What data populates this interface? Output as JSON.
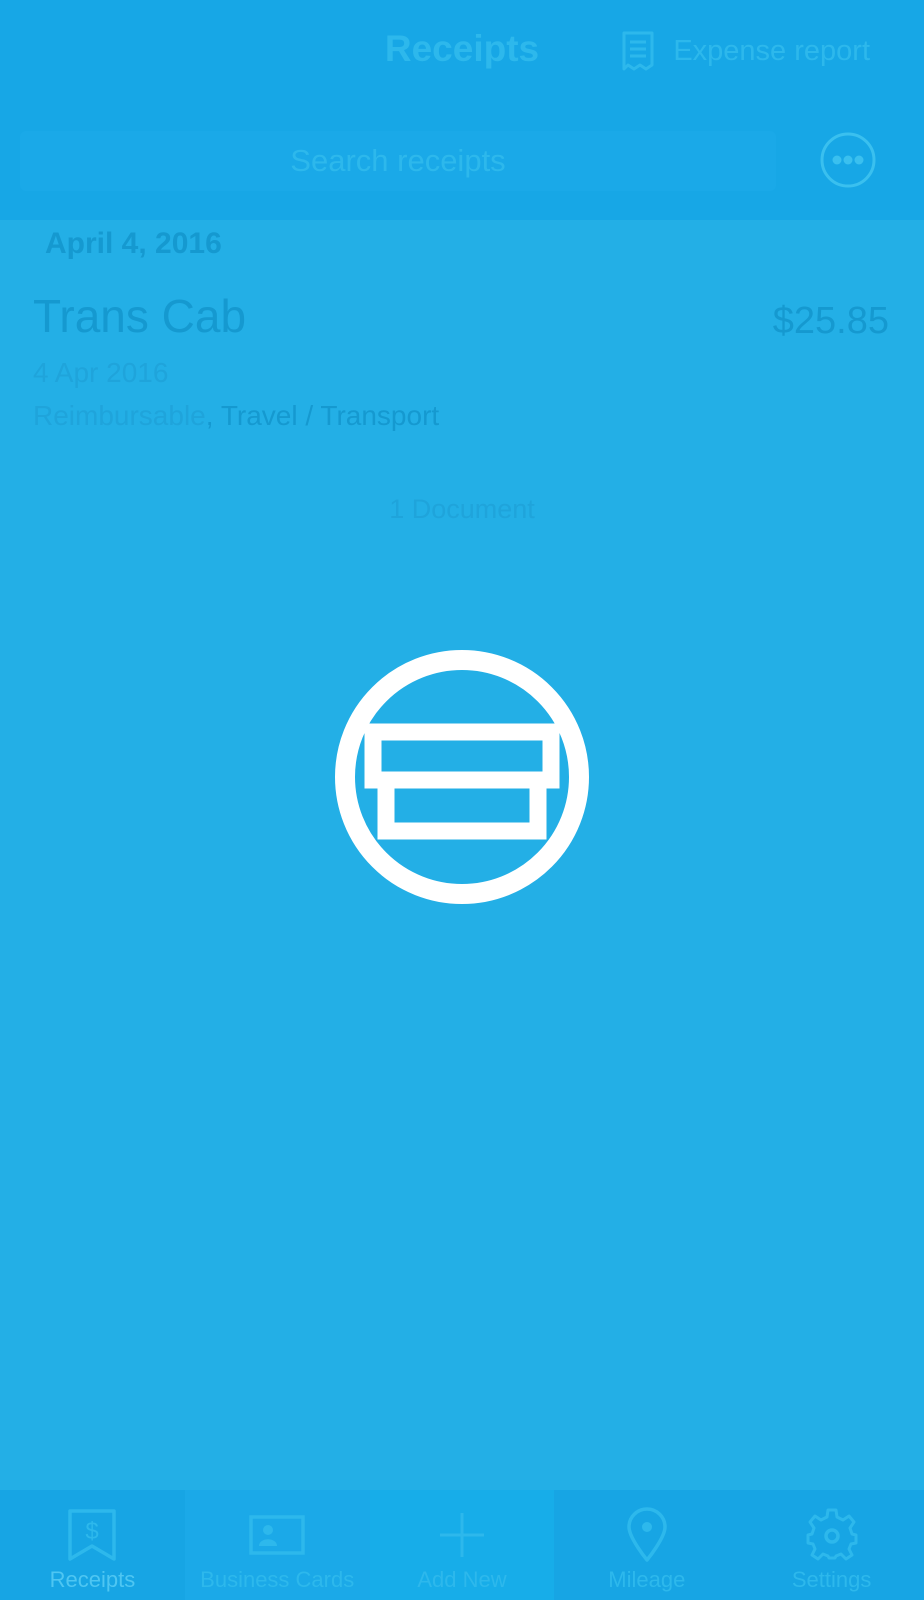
{
  "header": {
    "title": "Receipts",
    "expense_report_label": "Expense report"
  },
  "search": {
    "placeholder": "Search receipts"
  },
  "list": {
    "section_date": "April 4, 2016",
    "items": [
      {
        "merchant": "Trans Cab",
        "amount": "$25.85",
        "date": "4 Apr 2016",
        "tag_1": "Reimbursable",
        "tag_2": "Travel / Transport",
        "tag_separator": ", "
      }
    ],
    "document_count": "1 Document"
  },
  "overlay": {
    "icon": "archive-box-icon"
  },
  "tabbar": {
    "items": [
      {
        "label": "Receipts",
        "icon": "receipt-dollar-icon"
      },
      {
        "label": "Business Cards",
        "icon": "business-card-icon"
      },
      {
        "label": "Add New",
        "icon": "plus-icon"
      },
      {
        "label": "Mileage",
        "icon": "location-pin-icon"
      },
      {
        "label": "Settings",
        "icon": "gear-icon"
      }
    ]
  },
  "colors": {
    "background": "#23afe6",
    "header_bg": "#17a7e6",
    "overlay_icon": "#ffffff"
  }
}
